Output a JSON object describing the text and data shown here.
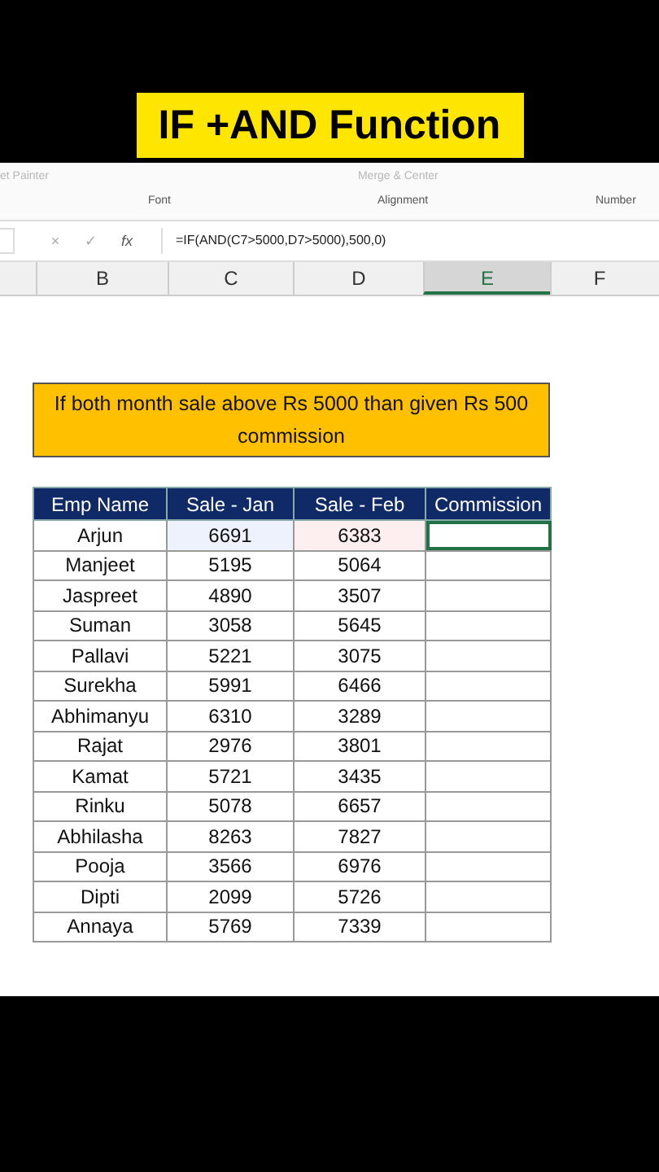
{
  "title": "IF +AND Function",
  "ribbon": {
    "clipboard_item": "et Painter",
    "merge_button": "Merge & Center",
    "groups": [
      "Font",
      "Alignment",
      "Number"
    ]
  },
  "formula_bar": {
    "cancel": "×",
    "enter": "✓",
    "fx": "fx",
    "formula": "=IF(AND(C7>5000,D7>5000),500,0)"
  },
  "column_headers": [
    {
      "label": "B",
      "selected": false
    },
    {
      "label": "C",
      "selected": false
    },
    {
      "label": "D",
      "selected": false
    },
    {
      "label": "E",
      "selected": true
    },
    {
      "label": "F",
      "selected": false
    }
  ],
  "note": "If both month sale above Rs 5000 than given Rs 500 commission",
  "table": {
    "columns": [
      "Emp Name",
      "Sale - Jan",
      "Sale - Feb",
      "Commission"
    ],
    "rows": [
      {
        "name": "Arjun",
        "jan": "6691",
        "feb": "6383",
        "selected": true
      },
      {
        "name": "Manjeet",
        "jan": "5195",
        "feb": "5064",
        "selected": false
      },
      {
        "name": "Jaspreet",
        "jan": "4890",
        "feb": "3507",
        "selected": false
      },
      {
        "name": "Suman",
        "jan": "3058",
        "feb": "5645",
        "selected": false
      },
      {
        "name": "Pallavi",
        "jan": "5221",
        "feb": "3075",
        "selected": false
      },
      {
        "name": "Surekha",
        "jan": "5991",
        "feb": "6466",
        "selected": false
      },
      {
        "name": "Abhimanyu",
        "jan": "6310",
        "feb": "3289",
        "selected": false
      },
      {
        "name": "Rajat",
        "jan": "2976",
        "feb": "3801",
        "selected": false
      },
      {
        "name": "Kamat",
        "jan": "5721",
        "feb": "3435",
        "selected": false
      },
      {
        "name": "Rinku",
        "jan": "5078",
        "feb": "6657",
        "selected": false
      },
      {
        "name": "Abhilasha",
        "jan": "8263",
        "feb": "7827",
        "selected": false
      },
      {
        "name": "Pooja",
        "jan": "3566",
        "feb": "6976",
        "selected": false
      },
      {
        "name": "Dipti",
        "jan": "2099",
        "feb": "5726",
        "selected": false
      },
      {
        "name": "Annaya",
        "jan": "5769",
        "feb": "7339",
        "selected": false
      }
    ]
  }
}
